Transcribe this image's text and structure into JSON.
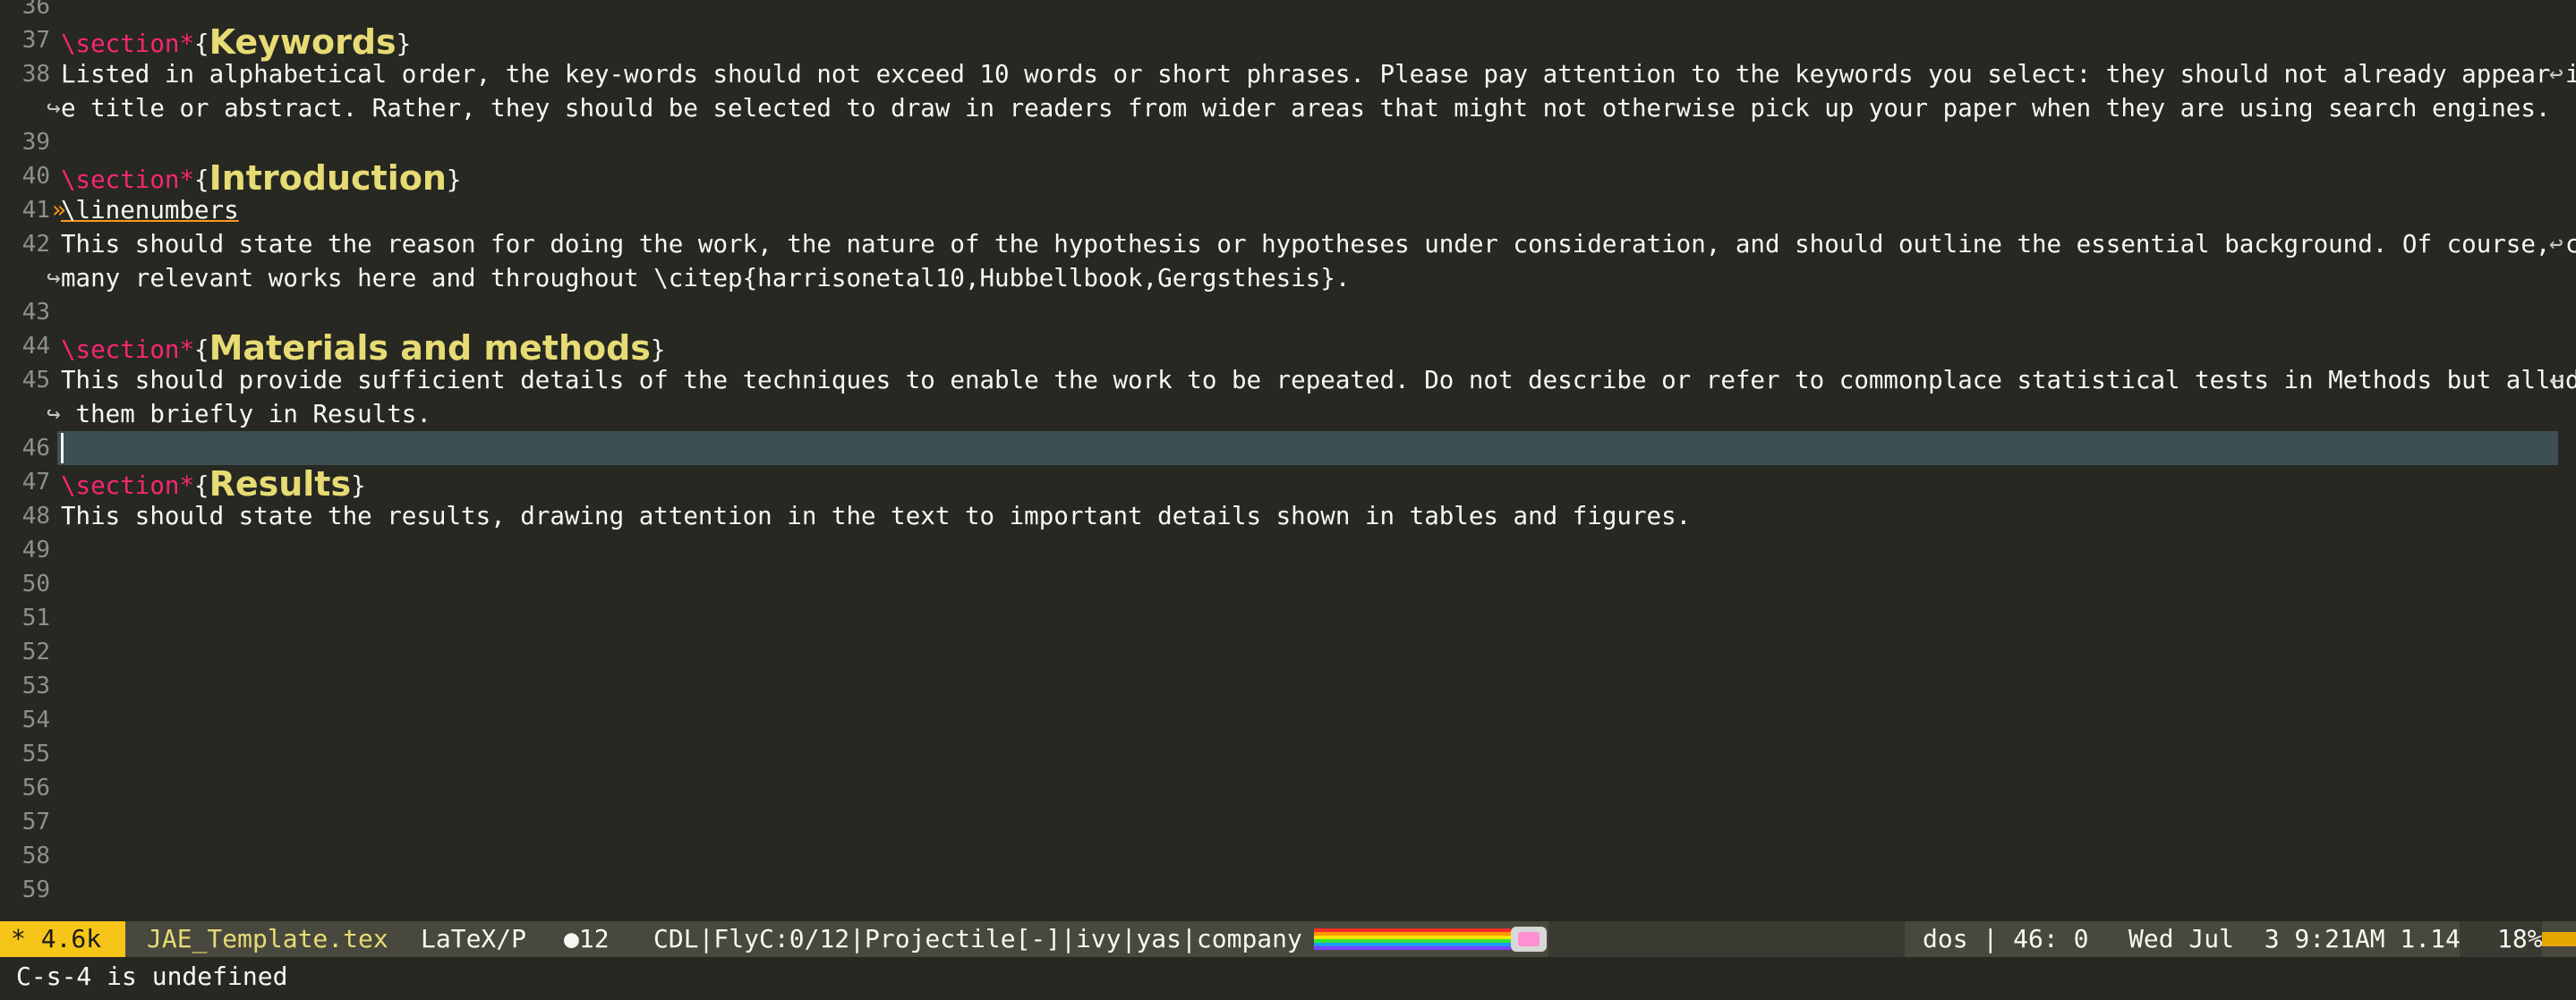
{
  "editor": {
    "lines": [
      {
        "num": "36"
      },
      {
        "num": "37",
        "cmd": "\\section",
        "star": "*",
        "open": "{",
        "heading": "Keywords",
        "close": "}"
      },
      {
        "num": "38",
        "text": "Listed in alphabetical order, the key-words should not exceed 10 words or short phrases. Please pay attention to the keywords you select: they should not already appear in th"
      },
      {
        "cont": "e title or abstract. Rather, they should be selected to draw in readers from wider areas that might not otherwise pick up your paper when they are using search engines."
      },
      {
        "num": "39"
      },
      {
        "num": "40",
        "cmd": "\\section",
        "star": "*",
        "open": "{",
        "heading": "Introduction",
        "close": "}"
      },
      {
        "num": "41",
        "indent": "»",
        "link": "\\linenumbers"
      },
      {
        "num": "42",
        "text": "This should state the reason for doing the work, the nature of the hypothesis or hypotheses under consideration, and should outline the essential background. Of course, cite "
      },
      {
        "cont": "many relevant works here and throughout \\citep{harrisonetal10,Hubbellbook,Gergsthesis}."
      },
      {
        "num": "43"
      },
      {
        "num": "44",
        "cmd": "\\section",
        "star": "*",
        "open": "{",
        "heading": "Materials and methods",
        "close": "}"
      },
      {
        "num": "45",
        "text": "This should provide sufficient details of the techniques to enable the work to be repeated. Do not describe or refer to commonplace statistical tests in Methods but allude to"
      },
      {
        "cont": " them briefly in Results."
      },
      {
        "num": "46",
        "current": true
      },
      {
        "num": "47",
        "cmd": "\\section",
        "star": "*",
        "open": "{",
        "heading": "Results",
        "close": "}"
      },
      {
        "num": "48",
        "text": "This should state the results, drawing attention in the text to important details shown in tables and figures."
      },
      {
        "num": "49"
      },
      {
        "num": "50"
      },
      {
        "num": "51"
      },
      {
        "num": "52"
      },
      {
        "num": "53"
      },
      {
        "num": "54"
      },
      {
        "num": "55"
      },
      {
        "num": "56"
      },
      {
        "num": "57"
      },
      {
        "num": "58"
      },
      {
        "num": "59"
      }
    ],
    "wrap_right_glyph": "↩",
    "wrap_left_glyph": "↪"
  },
  "modeline": {
    "modified": "* 4.6k",
    "filename": "JAE_Template.tex",
    "major_mode": "LaTeX/P",
    "diagnostics": "●12",
    "minor_modes": "CDL|FlyC:0/12|Projectile[-]|ivy|yas|company",
    "position": "dos | 46: 0",
    "datetime": "Wed Jul  3 9:21AM 1.14",
    "percent": "18%",
    "nyan_icon": "nyan-cat-icon",
    "colors": {
      "accent": "#f5c518",
      "filename": "#e6db74",
      "background": "#272822"
    }
  },
  "minibuffer": {
    "message": "C-s-4 is undefined"
  }
}
